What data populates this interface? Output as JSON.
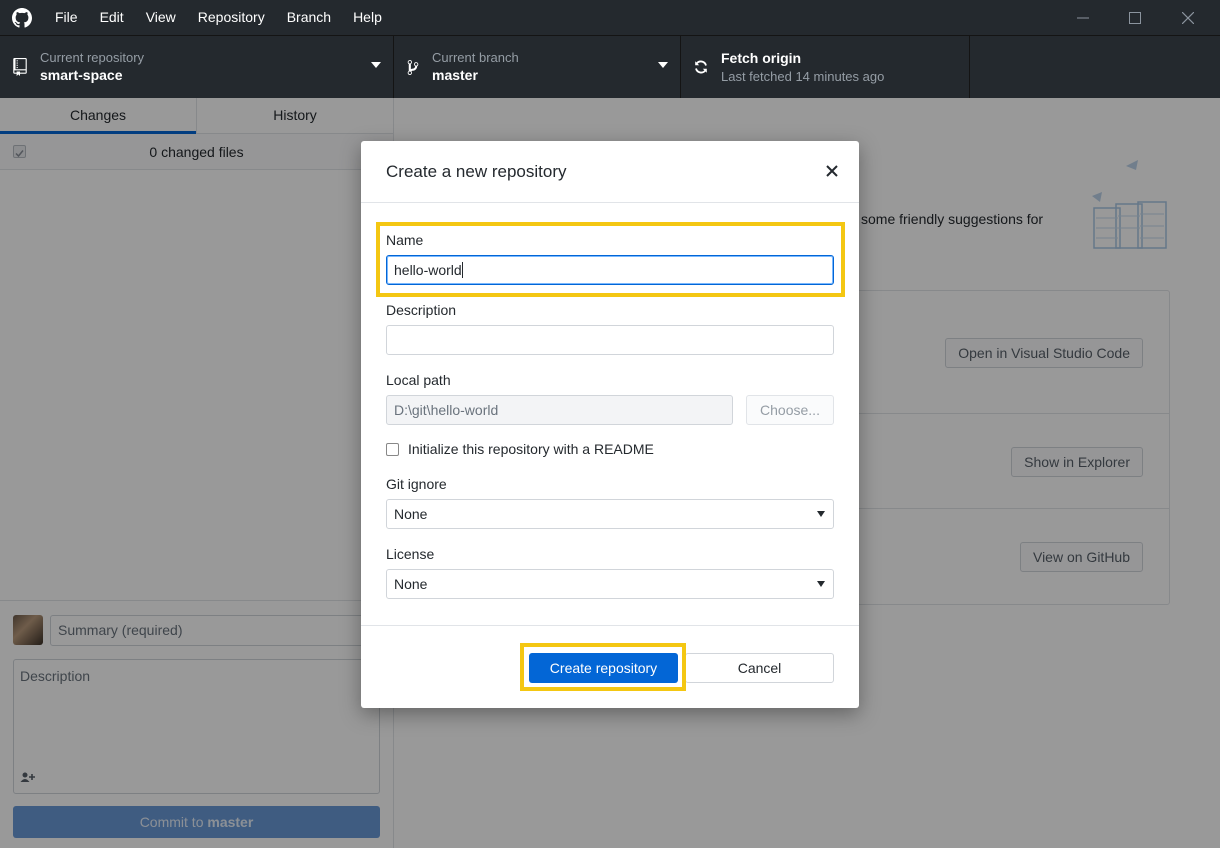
{
  "menu": {
    "items": [
      "File",
      "Edit",
      "View",
      "Repository",
      "Branch",
      "Help"
    ]
  },
  "window_controls": {
    "minimize_icon": "minimize-icon",
    "maximize_icon": "maximize-icon",
    "close_icon": "close-icon"
  },
  "toolbar": {
    "repository": {
      "caption": "Current repository",
      "value": "smart-space"
    },
    "branch": {
      "caption": "Current branch",
      "value": "master"
    },
    "fetch": {
      "title": "Fetch origin",
      "caption": "Last fetched 14 minutes ago"
    }
  },
  "sidebar": {
    "tabs": [
      "Changes",
      "History"
    ],
    "active_tab": "Changes",
    "changed_files": "0 changed files",
    "summary_placeholder": "Summary (required)",
    "description_placeholder": "Description",
    "commit_label_prefix": "Commit to ",
    "commit_label_branch": "master"
  },
  "main": {
    "suggestions_text": "some friendly suggestions for",
    "buttons": {
      "open_editor": "Open in Visual Studio Code",
      "show_explorer": "Show in Explorer",
      "view_github": "View on GitHub"
    }
  },
  "dialog": {
    "title": "Create a new repository",
    "name_label": "Name",
    "name_value": "hello-world",
    "description_label": "Description",
    "description_value": "",
    "local_path_label": "Local path",
    "local_path_value": "D:\\git\\hello-world",
    "choose_label": "Choose...",
    "readme_label": "Initialize this repository with a README",
    "readme_checked": false,
    "gitignore_label": "Git ignore",
    "gitignore_value": "None",
    "license_label": "License",
    "license_value": "None",
    "create_label": "Create repository",
    "cancel_label": "Cancel"
  },
  "colors": {
    "titlebar": "#24292e",
    "accent": "#0366d6",
    "highlight": "#f4c712"
  }
}
